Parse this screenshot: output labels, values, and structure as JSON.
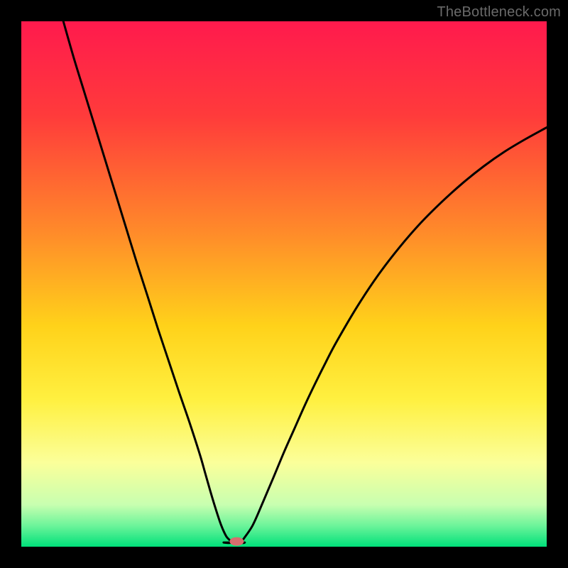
{
  "watermark": "TheBottleneck.com",
  "chart_data": {
    "type": "line",
    "title": "",
    "xlabel": "",
    "ylabel": "",
    "xlim": [
      0,
      100
    ],
    "ylim": [
      0,
      100
    ],
    "legend": false,
    "grid": false,
    "background_gradient": {
      "stops": [
        {
          "offset": 0.0,
          "color": "#ff1a4d"
        },
        {
          "offset": 0.18,
          "color": "#ff3b3b"
        },
        {
          "offset": 0.4,
          "color": "#ff8a2a"
        },
        {
          "offset": 0.58,
          "color": "#ffd21a"
        },
        {
          "offset": 0.72,
          "color": "#fff040"
        },
        {
          "offset": 0.84,
          "color": "#fbff9a"
        },
        {
          "offset": 0.92,
          "color": "#c8ffb0"
        },
        {
          "offset": 0.96,
          "color": "#6cf49a"
        },
        {
          "offset": 1.0,
          "color": "#00e07a"
        }
      ]
    },
    "optimum_x": 40,
    "marker": {
      "x": 41,
      "y": 1,
      "color": "#d76e6e",
      "rx": 10,
      "ry": 6
    },
    "series": [
      {
        "name": "bottleneck-curve-left",
        "x": [
          8,
          10,
          12,
          14,
          16,
          18,
          20,
          22,
          24,
          26,
          28,
          30,
          32,
          34,
          35,
          36,
          37,
          38,
          39,
          40
        ],
        "values": [
          100,
          93,
          86.5,
          80,
          73.5,
          67,
          60.5,
          54,
          47.8,
          41.5,
          35.5,
          29.5,
          23.7,
          17.5,
          14,
          10.5,
          7.2,
          4.2,
          2.0,
          0.8
        ]
      },
      {
        "name": "bottleneck-curve-right",
        "x": [
          42,
          44,
          46,
          48,
          50,
          52,
          54,
          56,
          58,
          60,
          64,
          68,
          72,
          76,
          80,
          84,
          88,
          92,
          96,
          100
        ],
        "values": [
          1.0,
          4.0,
          8.5,
          13.2,
          18.0,
          22.5,
          27.0,
          31.2,
          35.2,
          39.0,
          45.8,
          51.8,
          57.0,
          61.6,
          65.6,
          69.2,
          72.4,
          75.2,
          77.6,
          79.8
        ]
      }
    ],
    "flat_bottom": {
      "x_start": 38.5,
      "x_end": 42.5,
      "y": 0.8
    }
  }
}
